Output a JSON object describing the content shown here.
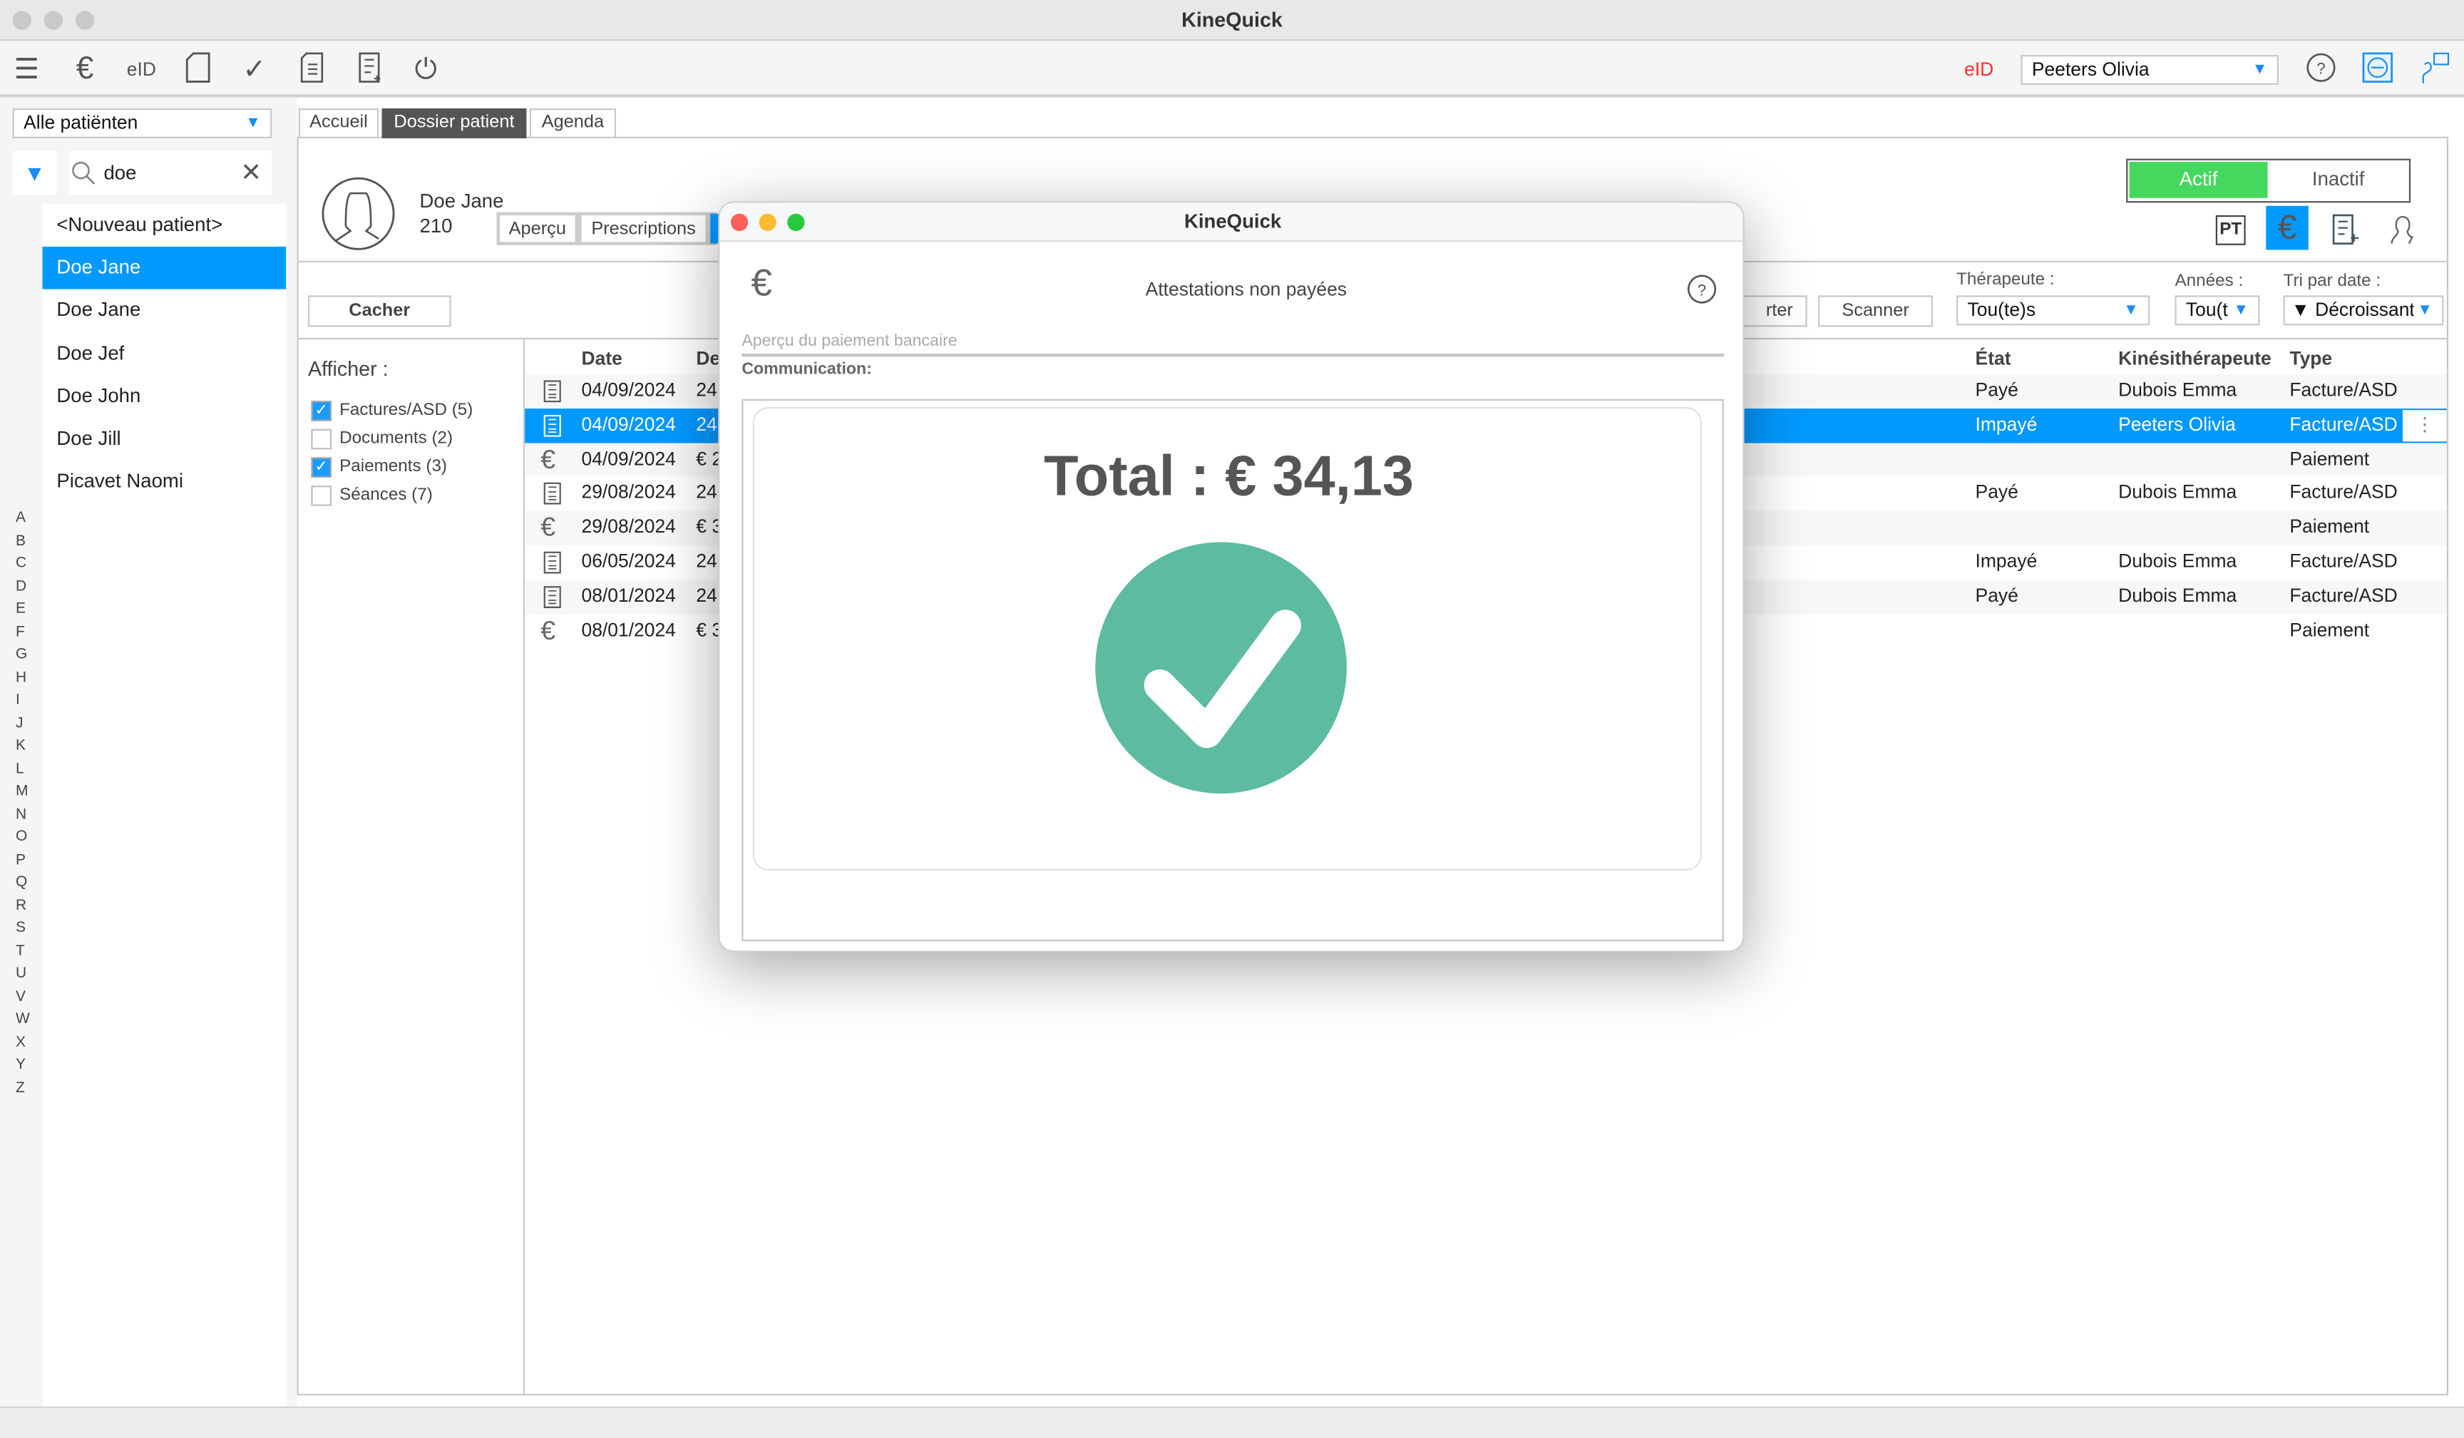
{
  "window": {
    "title": "KineQuick"
  },
  "toolbar": {
    "icons": [
      "menu-icon",
      "euro-bank-icon",
      "eid-icon",
      "document-icon",
      "checkmark-icon",
      "invoice-check-icon",
      "invoice-add-icon",
      "power-icon"
    ],
    "eid_text": "eID",
    "eid_color": "#ff2a2a",
    "therapist_select": "Peeters Olivia",
    "right_icons": [
      "help-icon",
      "remote-icon",
      "support-chat-icon"
    ]
  },
  "sidebar": {
    "filter_select": "Alle patiënten",
    "search_value": "doe",
    "patients": [
      "<Nouveau patient>",
      "Doe  Jane",
      "Doe  Jane",
      "Doe  Jef",
      "Doe  John",
      "Doe  Jill",
      "Picavet Naomi"
    ],
    "selected_index": 1,
    "alphabet": [
      "A",
      "B",
      "C",
      "D",
      "E",
      "F",
      "G",
      "H",
      "I",
      "J",
      "K",
      "L",
      "M",
      "N",
      "O",
      "P",
      "Q",
      "R",
      "S",
      "T",
      "U",
      "V",
      "W",
      "X",
      "Y",
      "Z"
    ]
  },
  "tabs": [
    "Accueil",
    "Dossier patient",
    "Agenda"
  ],
  "patient": {
    "name": "Doe  Jane",
    "number": "210",
    "subtabs": [
      "Aperçu",
      "Prescriptions"
    ]
  },
  "status_toggle": {
    "active": "Actif",
    "inactive": "Inactif",
    "active_color": "#44d95e"
  },
  "view_icons": {
    "pt": "PT"
  },
  "controls": {
    "hide_button": "Cacher",
    "import_button_partial": "rter",
    "scan_button": "Scanner",
    "therapist_label": "Thérapeute :",
    "therapist_value": "Tou(te)s",
    "years_label": "Années :",
    "years_value": "Tou(t",
    "sort_label": "Tri par date :",
    "sort_value": "▼ Décroissant"
  },
  "filters": {
    "title": "Afficher :",
    "items": [
      {
        "label": "Factures/ASD (5)",
        "checked": true
      },
      {
        "label": "Documents (2)",
        "checked": false
      },
      {
        "label": "Paiements (3)",
        "checked": true
      },
      {
        "label": "Séances (7)",
        "checked": false
      }
    ]
  },
  "table": {
    "headers": {
      "date": "Date",
      "desc": "De",
      "state": "État",
      "therapist": "Kinésithérapeute",
      "type": "Type"
    },
    "rows": [
      {
        "icon": "invoice",
        "date": "04/09/2024",
        "desc": "24",
        "state": "Payé",
        "therapist": "Dubois Emma",
        "type": "Facture/ASD"
      },
      {
        "icon": "invoice",
        "date": "04/09/2024",
        "desc": "24",
        "state": "Impayé",
        "therapist": "Peeters Olivia",
        "type": "Facture/ASD"
      },
      {
        "icon": "euro",
        "date": "04/09/2024",
        "desc": "€ 2",
        "state": "",
        "therapist": "",
        "type": "Paiement"
      },
      {
        "icon": "invoice",
        "date": "29/08/2024",
        "desc": "24",
        "state": "Payé",
        "therapist": "Dubois Emma",
        "type": "Facture/ASD"
      },
      {
        "icon": "euro",
        "date": "29/08/2024",
        "desc": "€ 3",
        "state": "",
        "therapist": "",
        "type": "Paiement"
      },
      {
        "icon": "invoice",
        "date": "06/05/2024",
        "desc": "24",
        "state": "Impayé",
        "therapist": "Dubois Emma",
        "type": "Facture/ASD"
      },
      {
        "icon": "invoice",
        "date": "08/01/2024",
        "desc": "24",
        "state": "Payé",
        "therapist": "Dubois Emma",
        "type": "Facture/ASD"
      },
      {
        "icon": "euro",
        "date": "08/01/2024",
        "desc": "€ 3",
        "state": "",
        "therapist": "",
        "type": "Paiement"
      }
    ],
    "selected_index": 1,
    "selection_color": "#0099ff"
  },
  "dialog": {
    "title": "KineQuick",
    "heading": "Attestations non payées",
    "preview_label": "Aperçu du paiement bancaire",
    "communication_label": "Communication:",
    "total": "Total : € 34,13",
    "success_color": "#5dbb9f"
  }
}
